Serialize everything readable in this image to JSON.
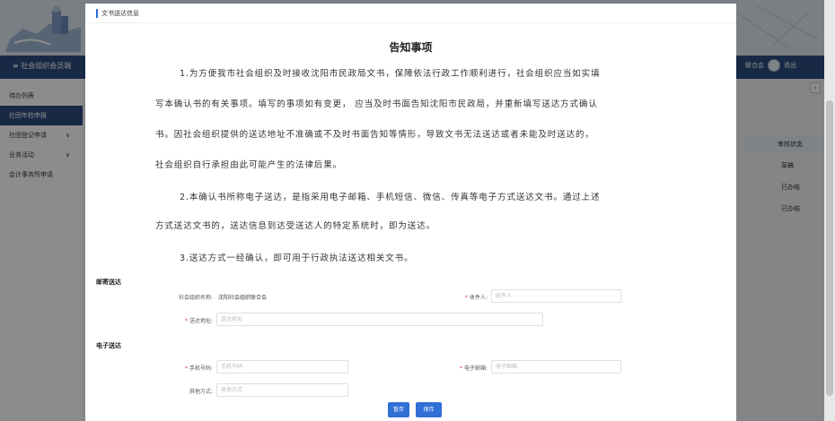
{
  "background": {
    "system_name": "社会组织会员端",
    "user_label": "联合会",
    "logout_label": "退出",
    "sidebar": [
      {
        "label": "待办列表",
        "active": false,
        "chevron": ""
      },
      {
        "label": "社团年检申报",
        "active": true,
        "chevron": ""
      },
      {
        "label": "社团登记申请",
        "active": false,
        "chevron": "∨"
      },
      {
        "label": "业务活动",
        "active": false,
        "chevron": "∨"
      },
      {
        "label": "会计事务所申请",
        "active": false,
        "chevron": ""
      }
    ],
    "table_header": "审核状态",
    "table_cells": [
      "草稿",
      "已办结",
      "已办结"
    ],
    "page_next": "›"
  },
  "dialog": {
    "header_title": "文书送达信息",
    "notice_title": "告知事项",
    "paragraphs": [
      "1.为方便我市社会组织及时接收沈阳市民政局文书，保障依法行政工作顺利进行，社会组织应当如实填",
      "写本确认书的有关事项。填写的事项如有变更， 应当及时书面告知沈阳市民政局，并重新填写送达方式确认",
      "书。因社会组织提供的送达地址不准确或不及时书面告知等情形，导致文书无法送达或者未能及时送达的，",
      "社会组织自行承担由此可能产生的法律后果。",
      "2.本确认书所称电子送达，是指采用电子邮箱、手机短信、微信、传真等电子方式送达文书。通过上述",
      "方式送达文书的，送达信息到达受送达人的特定系统时，即为送达。",
      "3.送达方式一经确认，即可用于行政执法送达相关文书。"
    ],
    "mail_section": "邮寄送达",
    "org_name_label": "社会组织名称:",
    "org_name_value": "沈阳社会组织联合会",
    "recipient_label": "收件人:",
    "recipient_placeholder": "收件人",
    "address_label": "送达地址:",
    "address_placeholder": "送达地址",
    "electronic_section": "电子送达",
    "phone_label": "手机号码:",
    "phone_placeholder": "手机号码",
    "email_label": "电子邮箱:",
    "email_placeholder": "电子邮箱",
    "other_label": "其他方式:",
    "other_placeholder": "其他方式",
    "required_mark": "*",
    "save_draft_label": "暂存",
    "save_label": "保存"
  }
}
